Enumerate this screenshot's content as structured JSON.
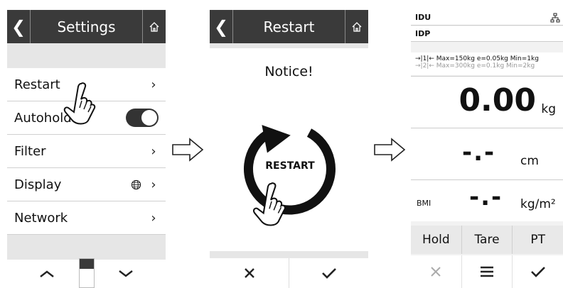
{
  "settings": {
    "title": "Settings",
    "items": [
      {
        "label": "Restart",
        "control": "chevron"
      },
      {
        "label": "Autohold",
        "control": "toggle",
        "toggle_on": true
      },
      {
        "label": "Filter",
        "control": "chevron"
      },
      {
        "label": "Display",
        "control": "globe-chevron"
      },
      {
        "label": "Network",
        "control": "chevron"
      }
    ],
    "footer": {
      "up_icon": "chevron-up-icon",
      "down_icon": "chevron-down-icon"
    }
  },
  "restart": {
    "title": "Restart",
    "notice": "Notice!",
    "button_label": "RESTART",
    "footer": {
      "cancel_icon": "x-icon",
      "confirm_icon": "check-icon"
    }
  },
  "scale": {
    "idu": "IDU",
    "idp": "IDP",
    "range1": "→|1|← Max=150kg e=0.05kg Min=1kg",
    "range2": "→|2|← Max=300kg e=0.1kg Min=2kg",
    "weight_value": "0.00",
    "weight_unit": "kg",
    "height_value": "-.-",
    "height_unit": "cm",
    "bmi_label": "BMI",
    "bmi_value": "-.-",
    "bmi_unit": "kg/m²",
    "buttons": [
      "Hold",
      "Tare",
      "PT"
    ],
    "bottom_icons": [
      "x-icon",
      "menu-icon",
      "check-icon"
    ]
  },
  "colors": {
    "header": "#3a3a3a",
    "panel_bg": "#e6e6e6",
    "accent": "#111111"
  }
}
